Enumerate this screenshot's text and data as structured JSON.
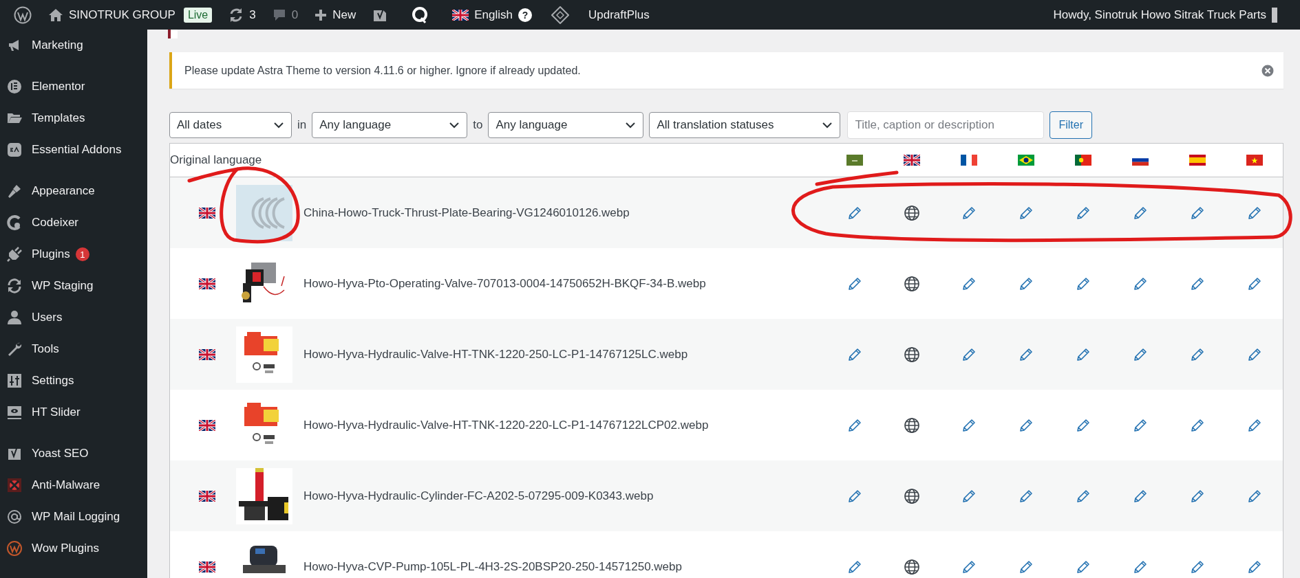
{
  "admin_bar": {
    "site": "SINOTRUK GROUP",
    "badge": "Live",
    "updates": "3",
    "comments": "0",
    "new": "New",
    "language": "English",
    "help": "?",
    "plugin": "UpdraftPlus",
    "greeting": "Howdy, Sinotruk Howo Sitrak Truck Parts"
  },
  "sidebar": {
    "groups": [
      [
        {
          "label": "Marketing"
        }
      ],
      [
        {
          "label": "Elementor"
        },
        {
          "label": "Templates"
        },
        {
          "label": "Essential Addons"
        }
      ],
      [
        {
          "label": "Appearance"
        },
        {
          "label": "Codeixer"
        },
        {
          "label": "Plugins",
          "badge": "1"
        },
        {
          "label": "WP Staging"
        },
        {
          "label": "Users"
        },
        {
          "label": "Tools"
        },
        {
          "label": "Settings"
        },
        {
          "label": "HT Slider"
        }
      ],
      [
        {
          "label": "Yoast SEO"
        },
        {
          "label": "Anti-Malware"
        },
        {
          "label": "WP Mail Logging"
        },
        {
          "label": "Wow Plugins"
        }
      ]
    ]
  },
  "notice": {
    "text": "Please update Astra Theme to version 4.11.6 or higher. Ignore if already updated."
  },
  "filters": {
    "items": [
      {
        "kind": "select",
        "value": "All dates"
      },
      {
        "kind": "text",
        "value": "in"
      },
      {
        "kind": "select",
        "value": "Any language"
      },
      {
        "kind": "text",
        "value": "to"
      },
      {
        "kind": "select",
        "value": "Any language"
      },
      {
        "kind": "select",
        "value": "All translation statuses"
      }
    ],
    "search": {
      "placeholder": "Title, caption or description"
    },
    "button": "Filter"
  },
  "table": {
    "header": "Original language",
    "rows": [
      {
        "file": "China-Howo-Truck-Thrust-Plate-Bearing-VG1246010126.webp",
        "actions": [
          {
            "kind": "edit"
          },
          {
            "kind": "original"
          },
          {
            "kind": "edit"
          },
          {
            "kind": "edit"
          },
          {
            "kind": "edit"
          },
          {
            "kind": "edit"
          },
          {
            "kind": "edit"
          },
          {
            "kind": "edit"
          }
        ]
      },
      {
        "file": "Howo-Hyva-Pto-Operating-Valve-707013-0004-14750652H-BKQF-34-B.webp",
        "actions": [
          {
            "kind": "edit"
          },
          {
            "kind": "original"
          },
          {
            "kind": "edit"
          },
          {
            "kind": "edit"
          },
          {
            "kind": "edit"
          },
          {
            "kind": "edit"
          },
          {
            "kind": "edit"
          },
          {
            "kind": "edit"
          }
        ]
      },
      {
        "file": "Howo-Hyva-Hydraulic-Valve-HT-TNK-1220-250-LC-P1-14767125LC.webp",
        "actions": [
          {
            "kind": "edit"
          },
          {
            "kind": "original"
          },
          {
            "kind": "edit"
          },
          {
            "kind": "edit"
          },
          {
            "kind": "edit"
          },
          {
            "kind": "edit"
          },
          {
            "kind": "edit"
          },
          {
            "kind": "edit"
          }
        ]
      },
      {
        "file": "Howo-Hyva-Hydraulic-Valve-HT-TNK-1220-220-LC-P1-14767122LCP02.webp",
        "actions": [
          {
            "kind": "edit"
          },
          {
            "kind": "original"
          },
          {
            "kind": "edit"
          },
          {
            "kind": "edit"
          },
          {
            "kind": "edit"
          },
          {
            "kind": "edit"
          },
          {
            "kind": "edit"
          },
          {
            "kind": "edit"
          }
        ]
      },
      {
        "file": "Howo-Hyva-Hydraulic-Cylinder-FC-A202-5-07295-009-K0343.webp",
        "actions": [
          {
            "kind": "edit"
          },
          {
            "kind": "original"
          },
          {
            "kind": "edit"
          },
          {
            "kind": "edit"
          },
          {
            "kind": "edit"
          },
          {
            "kind": "edit"
          },
          {
            "kind": "edit"
          },
          {
            "kind": "edit"
          }
        ]
      },
      {
        "file": "Howo-Hyva-CVP-Pump-105L-PL-4H3-2S-20BSP20-250-14571250.webp",
        "actions": [
          {
            "kind": "edit"
          },
          {
            "kind": "original"
          },
          {
            "kind": "edit"
          },
          {
            "kind": "edit"
          },
          {
            "kind": "edit"
          },
          {
            "kind": "edit"
          },
          {
            "kind": "edit"
          },
          {
            "kind": "edit"
          }
        ]
      }
    ]
  }
}
